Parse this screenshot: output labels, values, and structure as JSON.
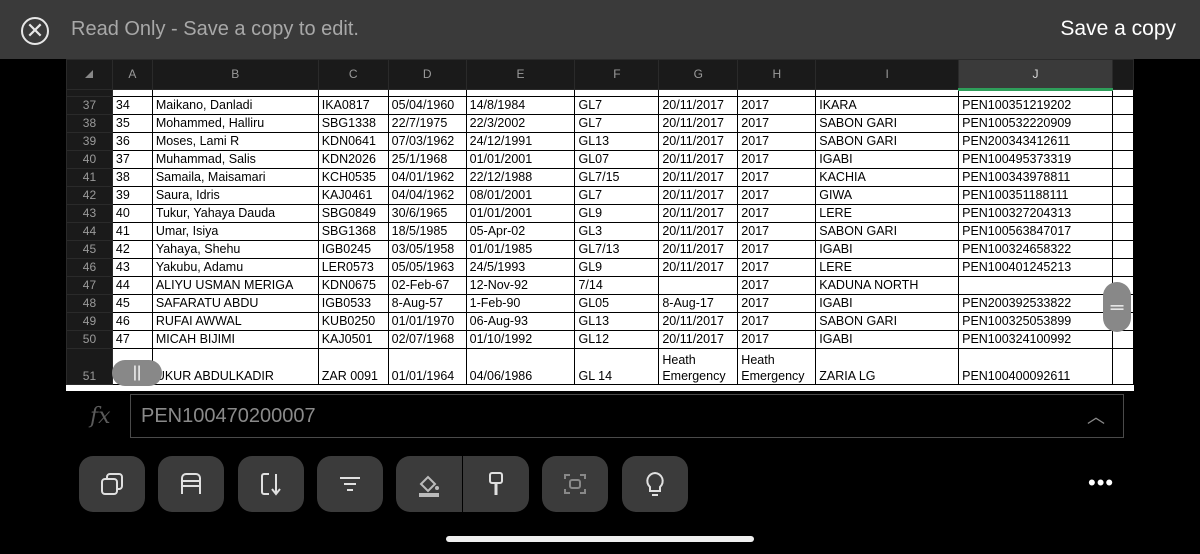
{
  "topbar": {
    "readonly_text": "Read Only - Save a copy to edit.",
    "save_label": "Save a copy"
  },
  "grid": {
    "columns": [
      "A",
      "B",
      "C",
      "D",
      "E",
      "F",
      "G",
      "H",
      "I",
      "J"
    ],
    "rows": [
      {
        "num": "37",
        "cells": [
          "34",
          "Maikano, Danladi",
          "IKA0817",
          "05/04/1960",
          "14/8/1984",
          "GL7",
          "20/11/2017",
          "2017",
          "IKARA",
          "PEN100351219202"
        ]
      },
      {
        "num": "38",
        "cells": [
          "35",
          "Mohammed, Halliru",
          "SBG1338",
          "22/7/1975",
          "22/3/2002",
          "GL7",
          "20/11/2017",
          "2017",
          "SABON GARI",
          "PEN100532220909"
        ]
      },
      {
        "num": "39",
        "cells": [
          "36",
          "Moses, Lami R",
          "KDN0641",
          "07/03/1962",
          "24/12/1991",
          "GL13",
          "20/11/2017",
          "2017",
          "SABON GARI",
          "PEN200343412611"
        ]
      },
      {
        "num": "40",
        "cells": [
          "37",
          "Muhammad, Salis",
          "KDN2026",
          "25/1/1968",
          "01/01/2001",
          "GL07",
          "20/11/2017",
          "2017",
          "IGABI",
          "PEN100495373319"
        ]
      },
      {
        "num": "41",
        "cells": [
          "38",
          "Samaila, Maisamari",
          "KCH0535",
          "04/01/1962",
          "22/12/1988",
          "GL7/15",
          "20/11/2017",
          "2017",
          "KACHIA",
          "PEN100343978811"
        ]
      },
      {
        "num": "42",
        "cells": [
          "39",
          "Saura, Idris",
          "KAJ0461",
          "04/04/1962",
          "08/01/2001",
          "GL7",
          "20/11/2017",
          "2017",
          "GIWA",
          "PEN100351188111"
        ]
      },
      {
        "num": "43",
        "cells": [
          "40",
          "Tukur, Yahaya Dauda",
          "SBG0849",
          "30/6/1965",
          "01/01/2001",
          "GL9",
          "20/11/2017",
          "2017",
          "LERE",
          "PEN100327204313"
        ]
      },
      {
        "num": "44",
        "cells": [
          "41",
          "Umar, Isiya",
          "SBG1368",
          "18/5/1985",
          "05-Apr-02",
          "GL3",
          "20/11/2017",
          "2017",
          "SABON GARI",
          "PEN100563847017"
        ]
      },
      {
        "num": "45",
        "cells": [
          "42",
          "Yahaya, Shehu",
          "IGB0245",
          "03/05/1958",
          "01/01/1985",
          "GL7/13",
          "20/11/2017",
          "2017",
          "IGABI",
          "PEN100324658322"
        ]
      },
      {
        "num": "46",
        "cells": [
          "43",
          "Yakubu, Adamu",
          "LER0573",
          "05/05/1963",
          "24/5/1993",
          "GL9",
          "20/11/2017",
          "2017",
          "LERE",
          "PEN100401245213"
        ]
      },
      {
        "num": "47",
        "cells": [
          "44",
          "ALIYU USMAN MERIGA",
          "KDN0675",
          "02-Feb-67",
          "12-Nov-92",
          "7/14",
          "",
          "2017",
          "KADUNA NORTH",
          ""
        ]
      },
      {
        "num": "48",
        "cells": [
          "45",
          "SAFARATU ABDU",
          "IGB0533",
          "8-Aug-57",
          "1-Feb-90",
          "GL05",
          "8-Aug-17",
          "2017",
          "IGABI",
          "PEN200392533822"
        ]
      },
      {
        "num": "49",
        "cells": [
          "46",
          "RUFAI AWWAL",
          "KUB0250",
          "01/01/1970",
          "06-Aug-93",
          "GL13",
          "20/11/2017",
          "2017",
          "SABON GARI",
          "PEN100325053899"
        ]
      },
      {
        "num": "50",
        "cells": [
          "47",
          "MICAH BIJIMI",
          "KAJ0501",
          "02/07/1968",
          "01/10/1992",
          "GL12",
          "20/11/2017",
          "2017",
          "IGABI",
          "PEN100324100992"
        ]
      },
      {
        "num": "51",
        "cells": [
          "",
          "UKUR ABDULKADIR",
          "ZAR 0091",
          "01/01/1964",
          "04/06/1986",
          "GL 14",
          "Heath Emergency",
          "Heath Emergency",
          "ZARIA LG",
          "PEN100400092611"
        ]
      }
    ]
  },
  "formula_bar": {
    "fx_label": "fx",
    "value": "PEN100470200007"
  },
  "toolbar": {
    "items": [
      "copy-icon",
      "table-icon",
      "sort-icon",
      "filter-icon",
      "fill-color-icon",
      "format-painter-icon",
      "select-icon",
      "lightbulb-icon",
      "more-icon"
    ],
    "more_label": "•••"
  },
  "colors": {
    "topbar_bg": "#3a3a3a",
    "selected_col_underline": "#2e9e5a",
    "tool_bg": "#3b3b3b"
  }
}
